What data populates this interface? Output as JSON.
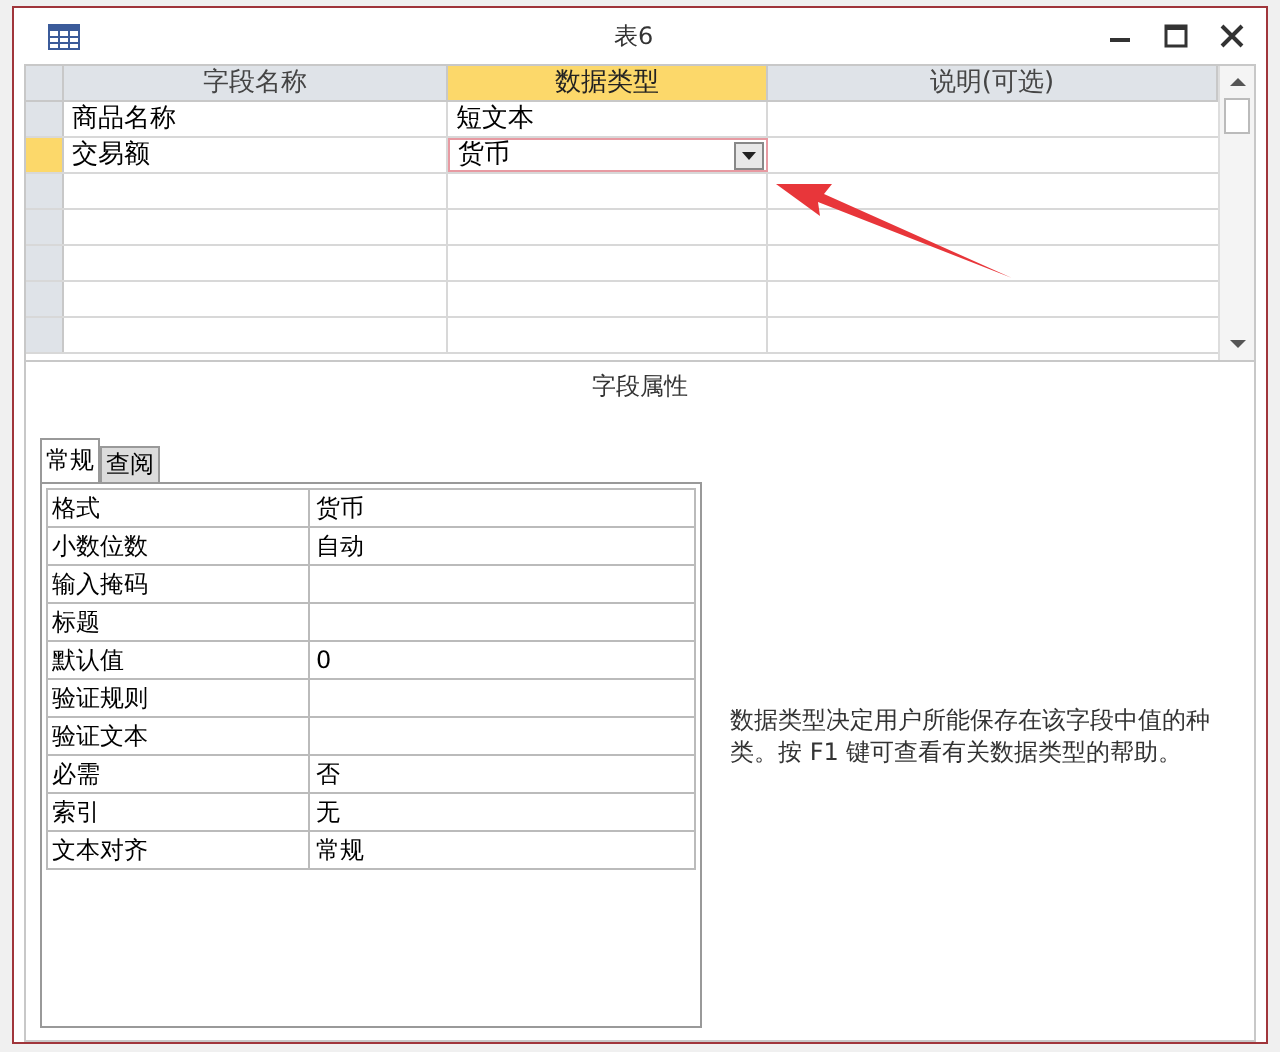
{
  "window": {
    "title": "表6"
  },
  "design_grid": {
    "columns": [
      {
        "label": "字段名称",
        "selected": false
      },
      {
        "label": "数据类型",
        "selected": true
      },
      {
        "label": "说明(可选)",
        "selected": false
      }
    ],
    "rows": [
      {
        "field_name": "商品名称",
        "data_type": "短文本",
        "selected": false
      },
      {
        "field_name": "交易额",
        "data_type": "货币",
        "selected": true
      }
    ]
  },
  "field_properties": {
    "title": "字段属性",
    "tabs": [
      {
        "label": "常规",
        "selected": true
      },
      {
        "label": "查阅",
        "selected": false
      }
    ],
    "properties": [
      {
        "name": "格式",
        "value": "货币"
      },
      {
        "name": "小数位数",
        "value": "自动"
      },
      {
        "name": "输入掩码"
      },
      {
        "name": "标题"
      },
      {
        "name": "默认值",
        "value": "0"
      },
      {
        "name": "验证规则"
      },
      {
        "name": "验证文本"
      },
      {
        "name": "必需",
        "value": "否"
      },
      {
        "name": "索引",
        "value": "无"
      },
      {
        "name": "文本对齐",
        "value": "常规"
      }
    ],
    "help_text": "数据类型决定用户所能保存在该字段中值的种类。按 F1 键可查看有关数据类型的帮助。"
  }
}
